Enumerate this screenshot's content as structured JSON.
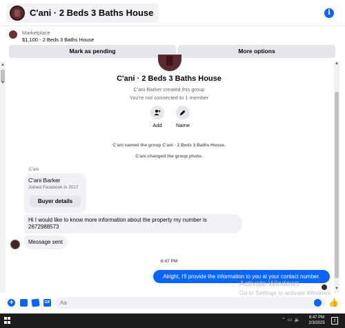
{
  "header": {
    "title": "C'ani · 2 Beds 3 Baths House",
    "info_icon": "i"
  },
  "marketplace": {
    "label": "Marketplace",
    "price_line": "$1,100 - 2 Beds 3 Baths House",
    "mark_pending_label": "Mark as pending",
    "more_options_label": "More options"
  },
  "intro": {
    "group_title": "C'ani · 2 Beds 3 Baths House",
    "created_by": "C'ani Barker created this group",
    "connection": "You're not connected to 1 member",
    "add_label": "Add",
    "name_label": "Name"
  },
  "system_messages": {
    "named": "C'ani named the group C'ani · 2 Beds 3 Baths House.",
    "photo": "C'ani changed the group photo."
  },
  "thread": {
    "sender_short": "C'ani",
    "profile_name": "C'ani Barker",
    "profile_joined": "Joined Facebook in 2017",
    "buyer_details_label": "Buyer details",
    "info_message_line1": "Hi I would like to know more information about the property my number is",
    "info_message_line2": "2672988573",
    "message_sent": "Message sent",
    "timestamp": "6:47 PM",
    "my_reply": "Alright, I'll provide the information to you at your contact number."
  },
  "watermark": {
    "line1": "Activate Windows",
    "line2": "Go to Settings to activate Windows."
  },
  "composer": {
    "placeholder": "Aa",
    "value": "",
    "gif_label": "GIF"
  },
  "taskbar": {
    "time": "6:47 PM",
    "date": "2/3/2025",
    "notifications": "2"
  },
  "colors": {
    "accent": "#0866ff",
    "bubble_gray": "#f0f2f5",
    "button_gray": "#e4e6eb",
    "taskbar": "#1c1c1c"
  }
}
